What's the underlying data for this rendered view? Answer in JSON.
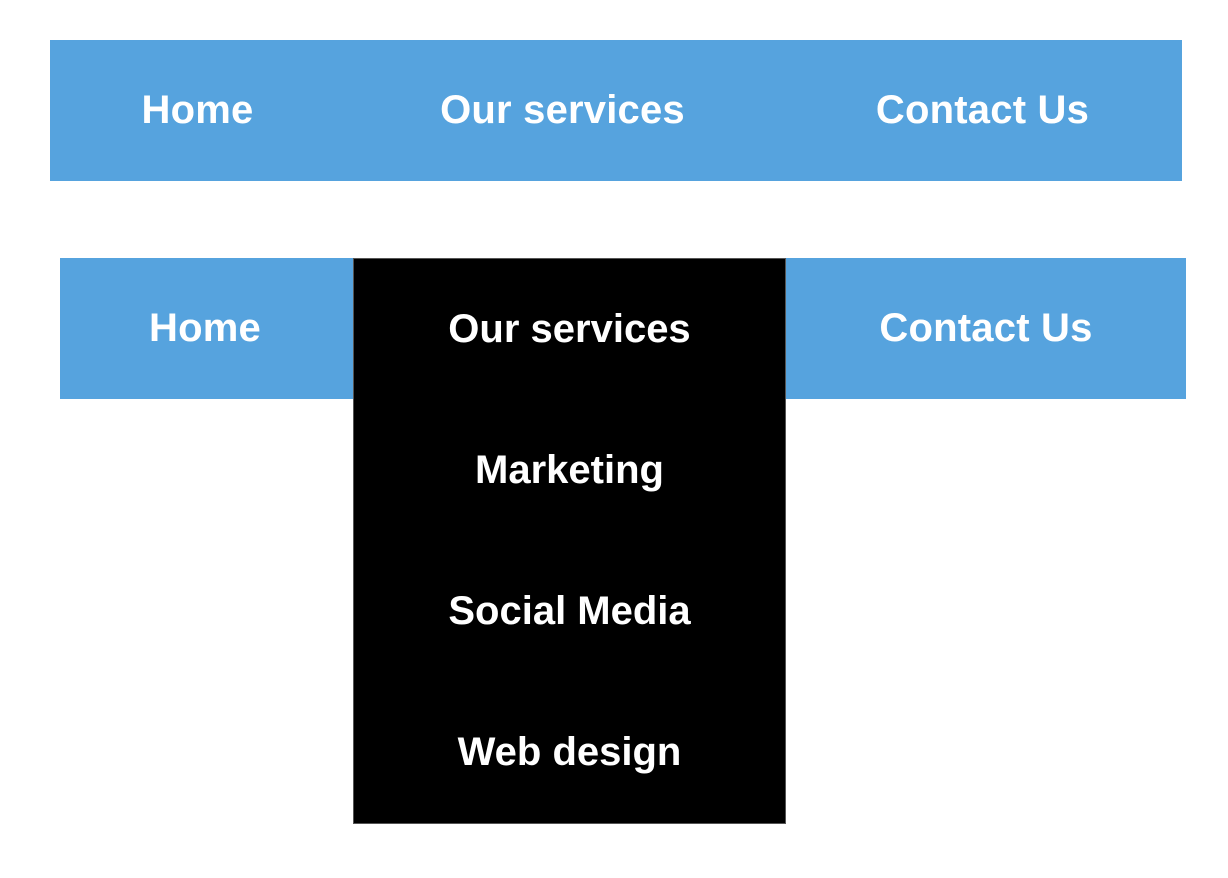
{
  "colors": {
    "nav_background": "#56a3de",
    "dropdown_background": "#000000",
    "text": "#ffffff"
  },
  "nav_top": {
    "items": [
      {
        "label": "Home"
      },
      {
        "label": "Our services"
      },
      {
        "label": "Contact Us"
      }
    ]
  },
  "nav_bottom": {
    "items": [
      {
        "label": "Home"
      },
      {
        "label": "Contact Us"
      }
    ],
    "dropdown": {
      "trigger_label": "Our services",
      "items": [
        {
          "label": "Marketing"
        },
        {
          "label": "Social Media"
        },
        {
          "label": "Web design"
        }
      ]
    }
  }
}
